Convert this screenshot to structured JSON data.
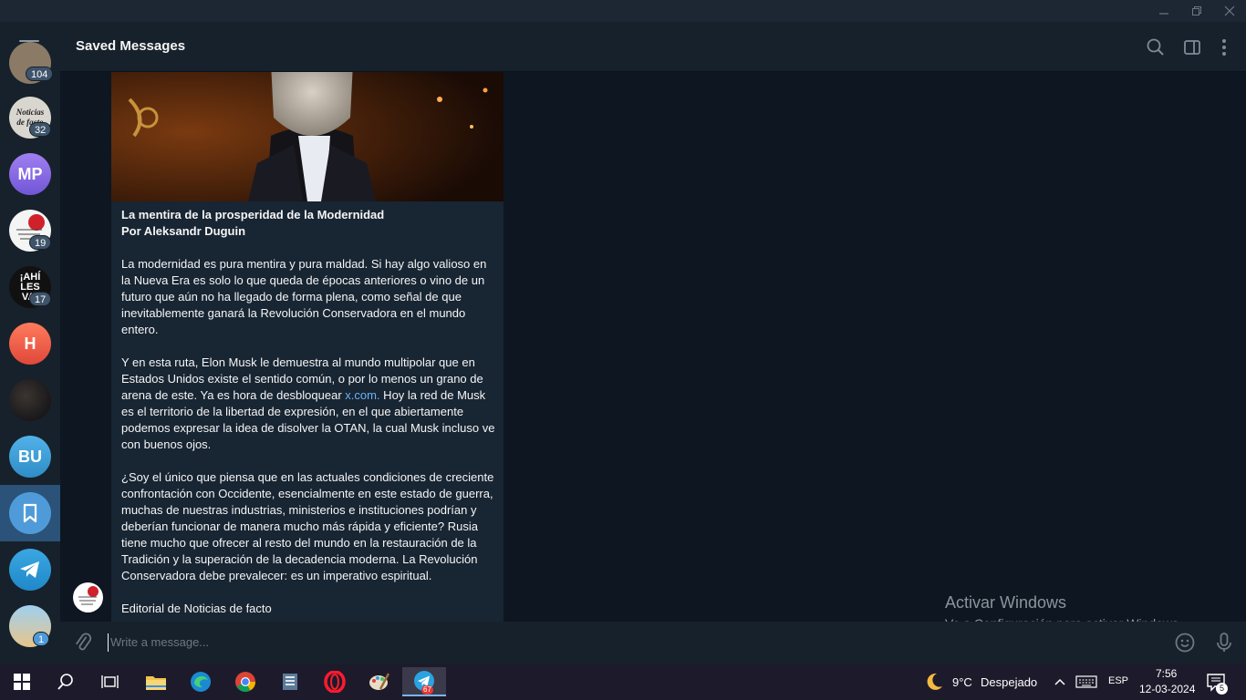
{
  "window": {
    "minimize_icon": "minimize-icon",
    "restore_icon": "restore-icon",
    "close_icon": "close-icon"
  },
  "sidebar": {
    "items": [
      {
        "kind": "image",
        "badge": "104"
      },
      {
        "kind": "image",
        "label": "Noticias de facto",
        "badge": "32"
      },
      {
        "kind": "initials",
        "initials": "MP",
        "color": "#8b6be0"
      },
      {
        "kind": "image",
        "badge": "19"
      },
      {
        "kind": "image",
        "label": "¡AHÍ LES VA!",
        "badge": "17"
      },
      {
        "kind": "initials",
        "initials": "H",
        "color": "#e5553d"
      },
      {
        "kind": "image"
      },
      {
        "kind": "initials",
        "initials": "BU",
        "color": "#3d9ad1"
      },
      {
        "kind": "saved",
        "active": true
      },
      {
        "kind": "telegram"
      },
      {
        "kind": "image",
        "badge": "1"
      }
    ]
  },
  "header": {
    "title": "Saved Messages"
  },
  "message": {
    "title_line1": "La mentira de la prosperidad de la Modernidad",
    "title_line2": "Por Aleksandr Duguin",
    "p1": "La modernidad es pura mentira y pura maldad. Si hay algo valioso en la Nueva Era es solo lo que queda de épocas anteriores o vino de un futuro que aún no ha llegado de forma plena, como señal de que inevitablemente ganará la Revolución Conservadora en el mundo entero.",
    "p2_before": "Y en esta ruta, Elon Musk le demuestra al mundo multipolar que en Estados Unidos existe el sentido común, o por lo menos un grano de arena de este. Ya es hora de desbloquear ",
    "p2_link": "x.com.",
    "p2_after": " Hoy la red de Musk es el territorio de la libertad de expresión, en el que abiertamente podemos expresar la idea de disolver la OTAN, la cual Musk incluso ve con buenos ojos.",
    "p3": "¿Soy el único que piensa que en las actuales condiciones de creciente confrontación con Occidente, esencialmente en este estado de guerra, muchas de nuestras industrias, ministerios e instituciones podrían y deberían funcionar de manera mucho más rápida y eficiente? Rusia tiene mucho que ofrecer al resto del mundo en la restauración de la Tradición y la superación de la decadencia moderna. La Revolución Conservadora debe prevalecer: es un imperativo espiritual.",
    "p4": "Editorial de Noticias de facto"
  },
  "input": {
    "placeholder": "Write a message..."
  },
  "watermark": {
    "line1": "Activar Windows",
    "line2": "Ve a Configuración para activar Windows."
  },
  "taskbar": {
    "telegram_badge": "67",
    "weather_temp": "9°C",
    "weather_text": "Despejado",
    "lang": "ESP",
    "time": "7:56",
    "date": "12-03-2024",
    "notif_count": "5"
  }
}
